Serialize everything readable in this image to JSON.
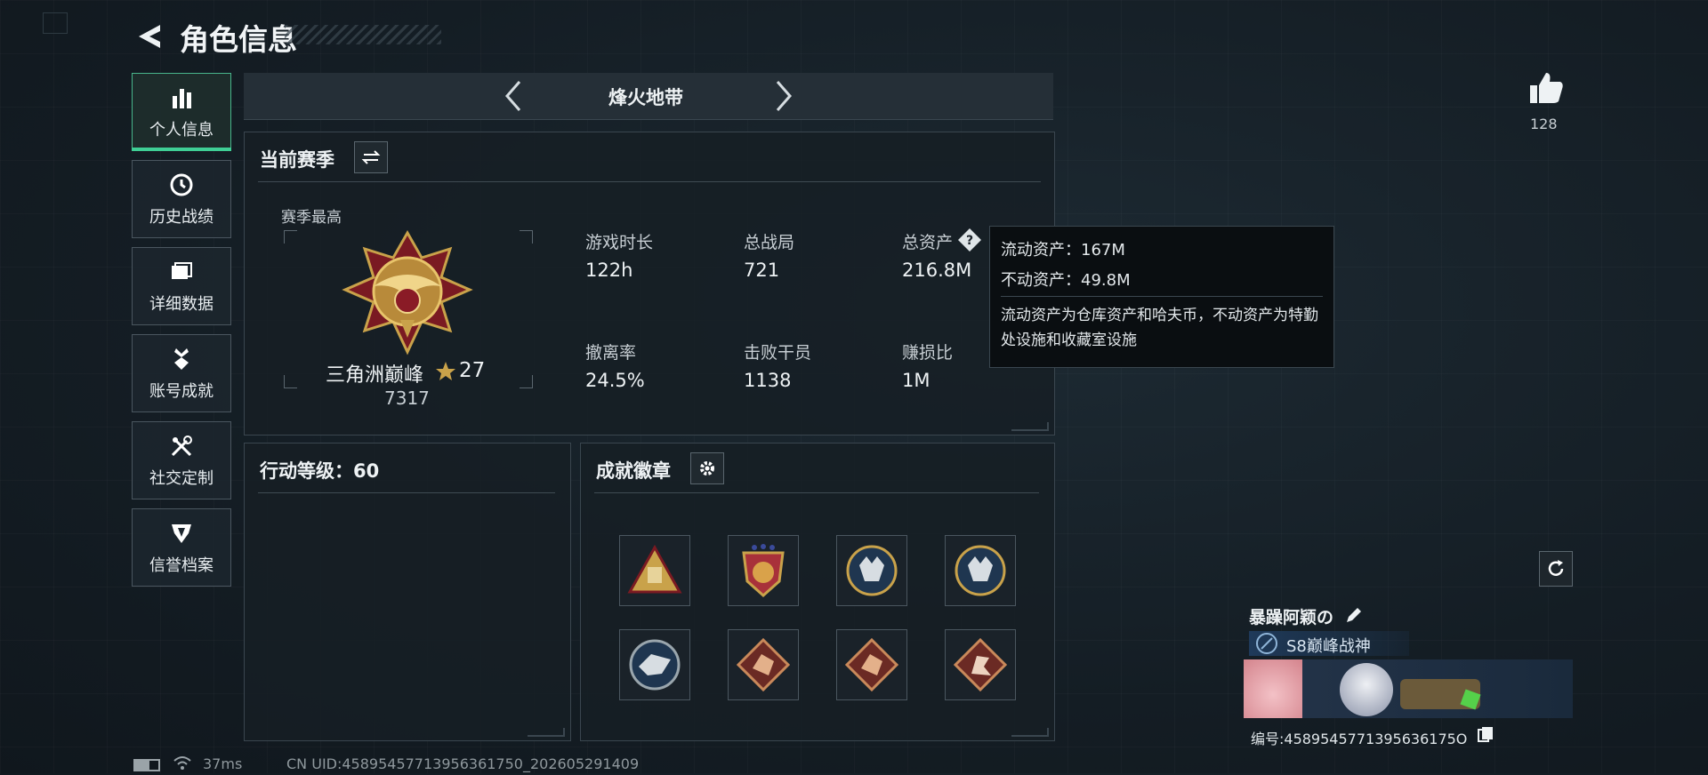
{
  "header": {
    "title": "角色信息"
  },
  "sidebar": {
    "items": [
      {
        "label": "个人信息",
        "icon": "bar-chart-icon",
        "active": true
      },
      {
        "label": "历史战绩",
        "icon": "clock-icon"
      },
      {
        "label": "详细数据",
        "icon": "folder-icon"
      },
      {
        "label": "账号成就",
        "icon": "medal-icon"
      },
      {
        "label": "社交定制",
        "icon": "tools-icon"
      },
      {
        "label": "信誉档案",
        "icon": "shield-icon"
      }
    ]
  },
  "mode_selector": {
    "label": "烽火地带"
  },
  "season": {
    "title": "当前赛季",
    "best_label": "赛季最高",
    "rank_name": "三角洲巅峰",
    "rank_stars": "27",
    "rank_points": "7317",
    "stats": [
      {
        "label": "游戏时长",
        "value": "122h"
      },
      {
        "label": "总战局",
        "value": "721"
      },
      {
        "label": "总资产",
        "value": "216.8M"
      },
      {
        "label": "撤离率",
        "value": "24.5%"
      },
      {
        "label": "击败干员",
        "value": "1138"
      },
      {
        "label": "赚损比",
        "value": "1M"
      }
    ]
  },
  "tooltip": {
    "liquid": "流动资产：167M",
    "fixed": "不动资产：49.8M",
    "desc": "流动资产为仓库资产和哈夫币，不动资产为特勤处设施和收藏室设施"
  },
  "action_level": {
    "title": "行动等级：60"
  },
  "badges": {
    "title": "成就徽章",
    "items": [
      "triangle-crate-badge",
      "shield-stars-badge",
      "wolf-round-badge",
      "wolf-round-badge",
      "wolf-round-badge",
      "dragon-diamond-badge",
      "dragon-diamond-badge",
      "dragon-diamond-badge"
    ]
  },
  "likes": {
    "count": "128"
  },
  "profile": {
    "name": "暴躁阿颖の",
    "title": "S8巅峰战神",
    "id_text": "编号:4589545771395636175O"
  },
  "status_bar": {
    "ping": "37ms",
    "uid": "CN UID:45895457713956361750_202605291409"
  },
  "colors": {
    "accent": "#3fcf95",
    "panel": "#161e25",
    "border": "#3a464f"
  }
}
